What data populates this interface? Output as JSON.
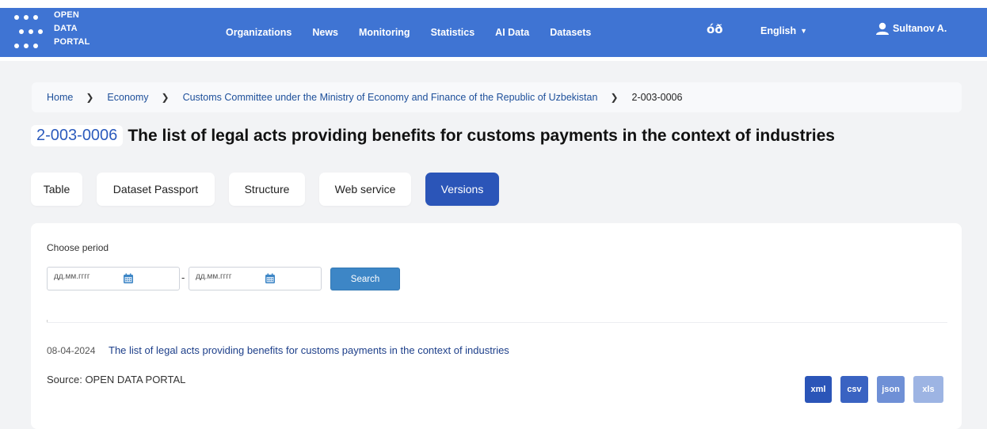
{
  "header": {
    "logo_lines": [
      "OPEN",
      "DATA",
      "PORTAL"
    ],
    "nav": [
      "Organizations",
      "News",
      "Monitoring",
      "Statistics",
      "AI Data",
      "Datasets"
    ],
    "accessibility_glyph": "óð",
    "language": "English",
    "user": "Sultanov A.",
    "colors": {
      "navbar": "#3f74d3"
    }
  },
  "breadcrumb": {
    "home": "Home",
    "category": "Economy",
    "organization": "Customs Committee under the Ministry of Economy and Finance of the Republic of Uzbekistan",
    "current": "2-003-0006"
  },
  "dataset": {
    "code": "2-003-0006",
    "title": "The list of legal acts providing benefits for customs payments in the context of industries"
  },
  "tabs": [
    {
      "label": "Table",
      "active": false
    },
    {
      "label": "Dataset Passport",
      "active": false
    },
    {
      "label": "Structure",
      "active": false
    },
    {
      "label": "Web service",
      "active": false
    },
    {
      "label": "Versions",
      "active": true
    }
  ],
  "filter": {
    "label": "Choose period",
    "from_placeholder": "дд.мм.гггг",
    "to_placeholder": "дд.мм.гггг",
    "separator": "-",
    "search_label": "Search"
  },
  "versions": [
    {
      "date": "08-04-2024",
      "title": "The list of legal acts providing benefits for customs payments in the context of industries",
      "source_label": "Source:",
      "source_value": "OPEN DATA PORTAL",
      "downloads": [
        {
          "label": "xml",
          "color": "#2b55b8"
        },
        {
          "label": "csv",
          "color": "#3a63c2"
        },
        {
          "label": "json",
          "color": "#6f90d6"
        },
        {
          "label": "xls",
          "color": "#9db4e3"
        }
      ]
    }
  ]
}
